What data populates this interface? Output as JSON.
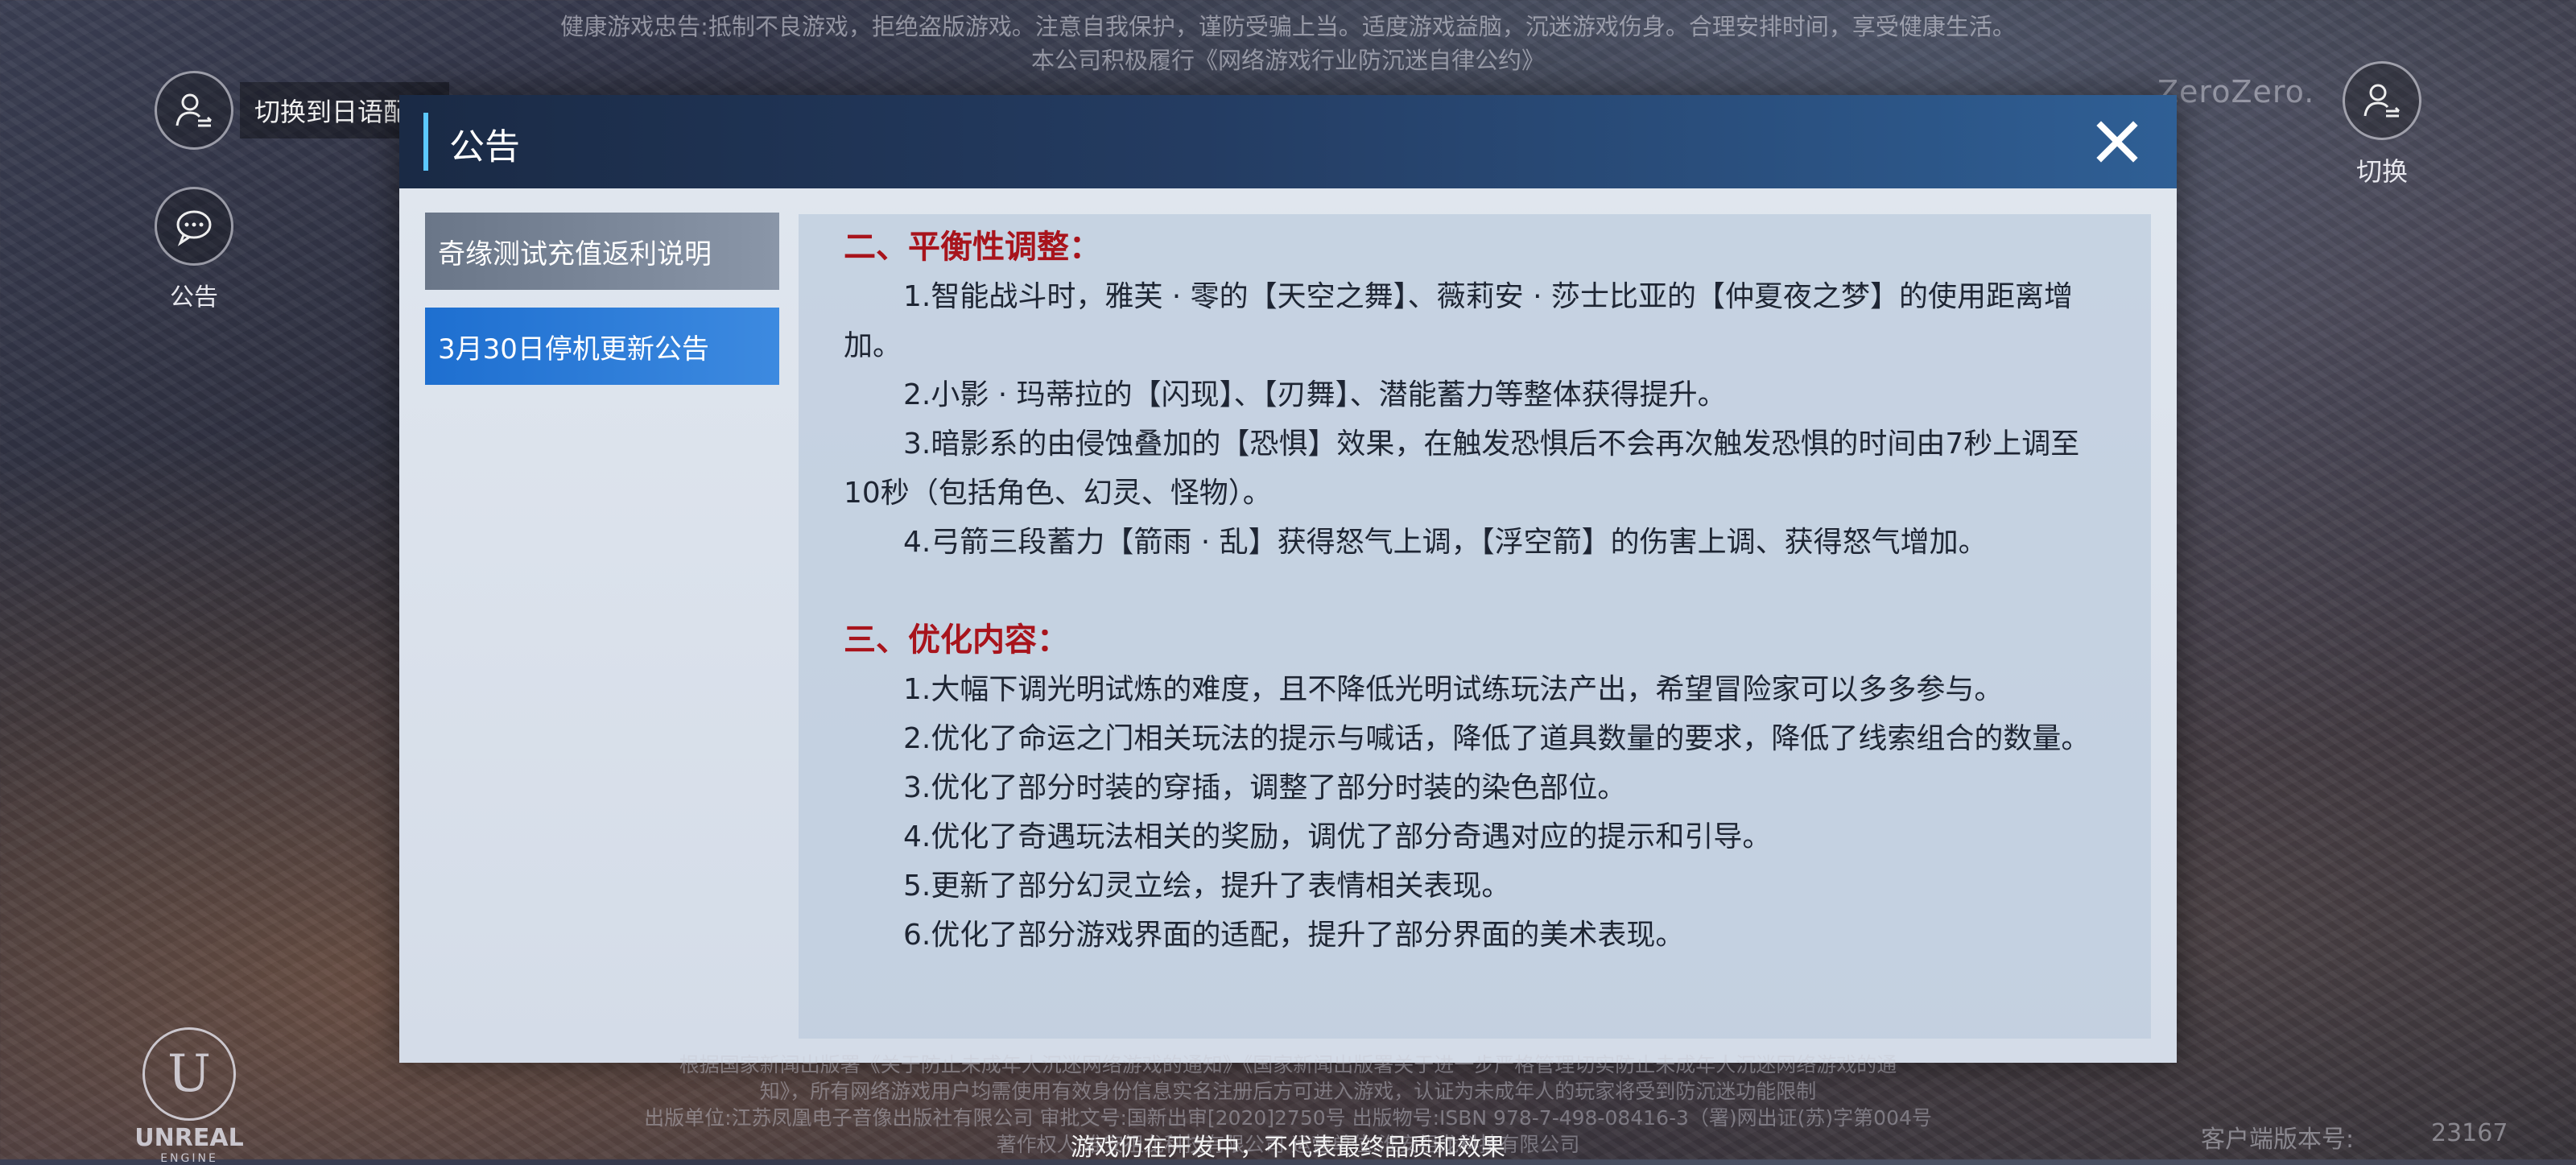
{
  "health_notice": {
    "line1": "健康游戏忠告:抵制不良游戏，拒绝盗版游戏。注意自我保护，谨防受骗上当。适度游戏益脑，沉迷游戏伤身。合理安排时间，享受健康生活。",
    "line2": "本公司积极履行《网络游戏行业防沉迷自律公约》"
  },
  "side_left": {
    "switch_label": "切换到日语配音",
    "notice_label": "公告"
  },
  "side_right": {
    "brand": "ZeroZero.",
    "switch_label": "切换"
  },
  "dialog": {
    "title": "公告",
    "tabs": [
      {
        "label": "奇缘测试充值返利说明"
      },
      {
        "label": "3月30日停机更新公告"
      }
    ],
    "sections": [
      {
        "title": "二、平衡性调整：",
        "items": [
          "1.智能战斗时，雅芙 · 零的【天空之舞】、薇莉安 · 莎士比亚的【仲夏夜之梦】的使用距离增加。",
          "2.小影 · 玛蒂拉的【闪现】、【刃舞】、潜能蓄力等整体获得提升。",
          "3.暗影系的由侵蚀叠加的【恐惧】效果，在触发恐惧后不会再次触发恐惧的时间由7秒上调至10秒（包括角色、幻灵、怪物）。",
          "4.弓箭三段蓄力【箭雨 · 乱】获得怒气上调，【浮空箭】的伤害上调、获得怒气增加。"
        ]
      },
      {
        "title": "三、优化内容：",
        "items": [
          "1.大幅下调光明试炼的难度，且不降低光明试练玩法产出，希望冒险家可以多多参与。",
          "2.优化了命运之门相关玩法的提示与喊话，降低了道具数量的要求，降低了线索组合的数量。",
          "3.优化了部分时装的穿插，调整了部分时装的染色部位。",
          "4.优化了奇遇玩法相关的奖励，调优了部分奇遇对应的提示和引导。",
          "5.更新了部分幻灵立绘，提升了表情相关表现。",
          "6.优化了部分游戏界面的适配，提升了部分界面的美术表现。"
        ]
      }
    ]
  },
  "footer": {
    "line1": "根据国家新闻出版署《关于防止未成年人沉迷网络游戏的通知》《国家新闻出版署关于进一步严格管理切实防止未成年人沉迷网络游戏的通",
    "line2": "知》，所有网络游戏用户均需使用有效身份信息实名注册后方可进入游戏，认证为未成年人的玩家将受到防沉迷功能限制",
    "line3": "出版单位:江苏凤凰电子音像出版社有限公司 审批文号:国新出审[2020]2750号 出版物号:ISBN 978-7-498-08416-3（署)网出证(苏)字第004号",
    "line4": "著作权人:淮安祖龙科技有限公司 运营单位:淮安祖龙科技有限公司",
    "dev_notice": "游戏仍在开发中，不代表最终品质和效果"
  },
  "engine_logo": {
    "letter": "U",
    "name": "UNREAL",
    "sub": "ENGINE"
  },
  "version": {
    "label": "客户端版本号:",
    "number": "23167"
  }
}
